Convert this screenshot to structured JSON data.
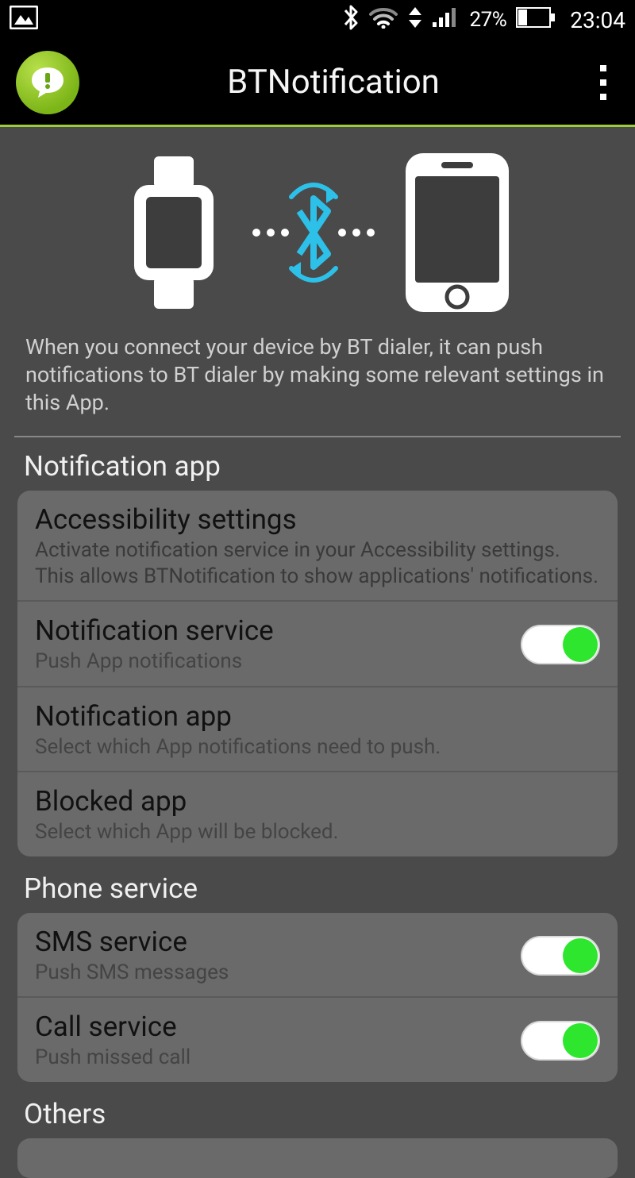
{
  "status": {
    "battery_percent": "27%",
    "time": "23:04"
  },
  "header": {
    "title": "BTNotification"
  },
  "hero": {
    "description": "When you connect your device by BT dialer, it can push notifications to BT dialer by making some relevant settings in this App."
  },
  "sections": {
    "notification_app": {
      "title": "Notification app",
      "items": {
        "accessibility": {
          "title": "Accessibility settings",
          "sub": "Activate notification service in your Accessibility settings. This allows BTNotification to show applications' notifications."
        },
        "service": {
          "title": "Notification service",
          "sub": "Push App notifications",
          "on": true
        },
        "app": {
          "title": "Notification app",
          "sub": "Select which App notifications need to push."
        },
        "blocked": {
          "title": "Blocked app",
          "sub": "Select which App will be blocked."
        }
      }
    },
    "phone_service": {
      "title": "Phone service",
      "items": {
        "sms": {
          "title": "SMS service",
          "sub": "Push SMS messages",
          "on": true
        },
        "call": {
          "title": "Call service",
          "sub": "Push missed call",
          "on": true
        }
      }
    },
    "others": {
      "title": "Others"
    }
  },
  "colors": {
    "accent": "#9ccc3c",
    "toggle_on": "#2ee62e"
  }
}
